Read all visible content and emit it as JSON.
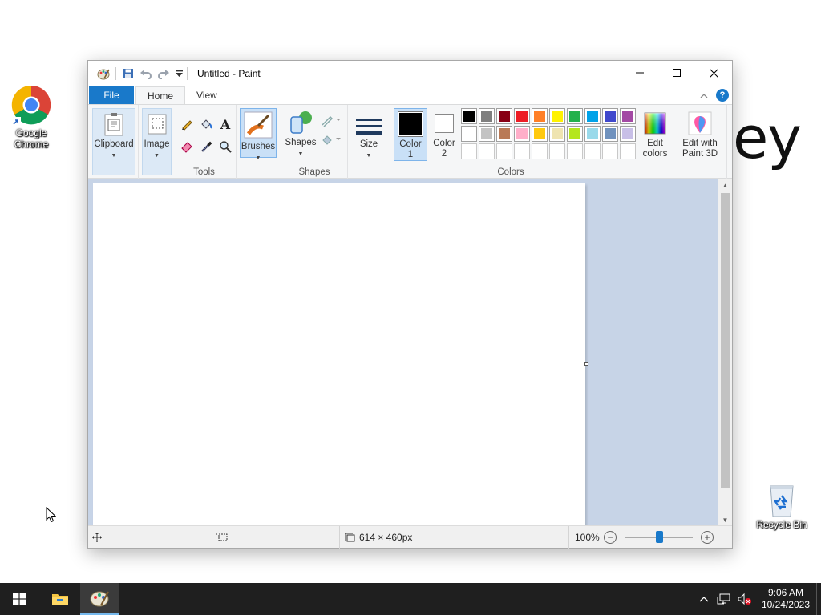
{
  "desktop": {
    "icons": [
      {
        "label": "Google Chrome"
      },
      {
        "label": "Recycle Bin"
      }
    ],
    "background_text": "ey"
  },
  "window": {
    "title": "Untitled - Paint",
    "tabs": [
      "File",
      "Home",
      "View"
    ],
    "active_tab": "Home"
  },
  "ribbon": {
    "groups": {
      "clipboard": {
        "button": "Clipboard"
      },
      "image": {
        "button": "Image"
      },
      "tools": {
        "label": "Tools"
      },
      "brushes": {
        "button": "Brushes"
      },
      "shapes": {
        "button": "Shapes",
        "label": "Shapes"
      },
      "size": {
        "button": "Size"
      },
      "colors": {
        "label": "Colors",
        "color1": "Color 1",
        "color2": "Color 2",
        "color1_value": "#000000",
        "color2_value": "#ffffff",
        "edit_colors": "Edit colors",
        "edit_paint3d": "Edit with Paint 3D",
        "palette_row1": [
          "#000000",
          "#7f7f7f",
          "#880015",
          "#ed1c24",
          "#ff7f27",
          "#fff200",
          "#22b14c",
          "#00a2e8",
          "#3f48cc",
          "#a349a4"
        ],
        "palette_row2": [
          "#ffffff",
          "#c3c3c3",
          "#b97a57",
          "#ffaec9",
          "#ffc90e",
          "#efe4b0",
          "#b5e61d",
          "#99d9ea",
          "#7092be",
          "#c8bfe7"
        ]
      }
    }
  },
  "statusbar": {
    "image_size": "614 × 460px",
    "zoom": "100%",
    "zoom_fraction": 0.5
  },
  "taskbar": {
    "time": "9:06 AM",
    "date": "10/24/2023"
  },
  "accent": "#1979ca"
}
